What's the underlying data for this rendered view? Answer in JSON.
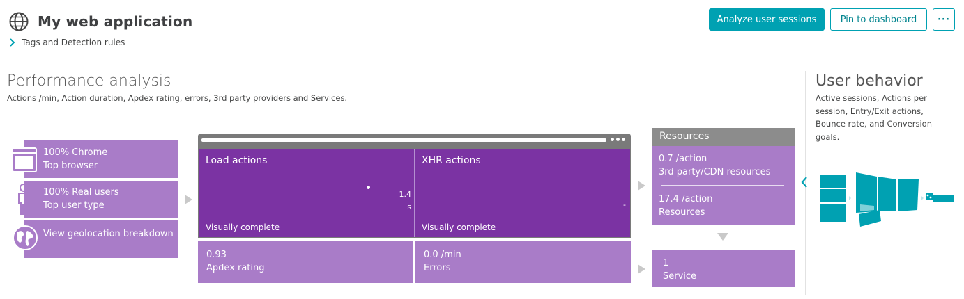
{
  "header": {
    "app_title": "My web application",
    "tags_link": "Tags and Detection rules",
    "icon": "globe-icon"
  },
  "actions": {
    "analyze": "Analyze user sessions",
    "pin": "Pin to dashboard",
    "more": "···"
  },
  "performance": {
    "title": "Performance analysis",
    "subtitle": "Actions /min, Action duration, Apdex rating, errors, 3rd party providers and Services."
  },
  "tiles": [
    {
      "line1": "100% Chrome",
      "line2": "Top browser",
      "icon": "browser-icon"
    },
    {
      "line1": "100% Real users",
      "line2": "Top user type",
      "icon": "user-icon"
    },
    {
      "line1": "View geolocation breakdown",
      "icon": "world-icon"
    }
  ],
  "load_actions": {
    "title": "Load actions",
    "footer": "Visually complete",
    "value": "1.4",
    "unit": "s"
  },
  "xhr_actions": {
    "title": "XHR actions",
    "footer": "Visually complete",
    "value": "-"
  },
  "apdex": {
    "value": "0.93",
    "label": "Apdex rating"
  },
  "errors": {
    "value": "0.0 /min",
    "label": "Errors"
  },
  "resources": {
    "title": "Resources",
    "third_party_value": "0.7 /action",
    "third_party_label": "3rd party/CDN resources",
    "resources_value": "17.4 /action",
    "resources_label": "Resources"
  },
  "services": {
    "value": "1",
    "label": "Service"
  },
  "user_behavior": {
    "title": "User behavior",
    "subtitle": "Active sessions, Actions per session, Entry/Exit actions, Bounce rate, and Conversion goals."
  },
  "colors": {
    "accent": "#00a1b2",
    "tile": "#a97cc8",
    "panel": "#7b33a3",
    "resources_header": "#8c8c8c"
  }
}
